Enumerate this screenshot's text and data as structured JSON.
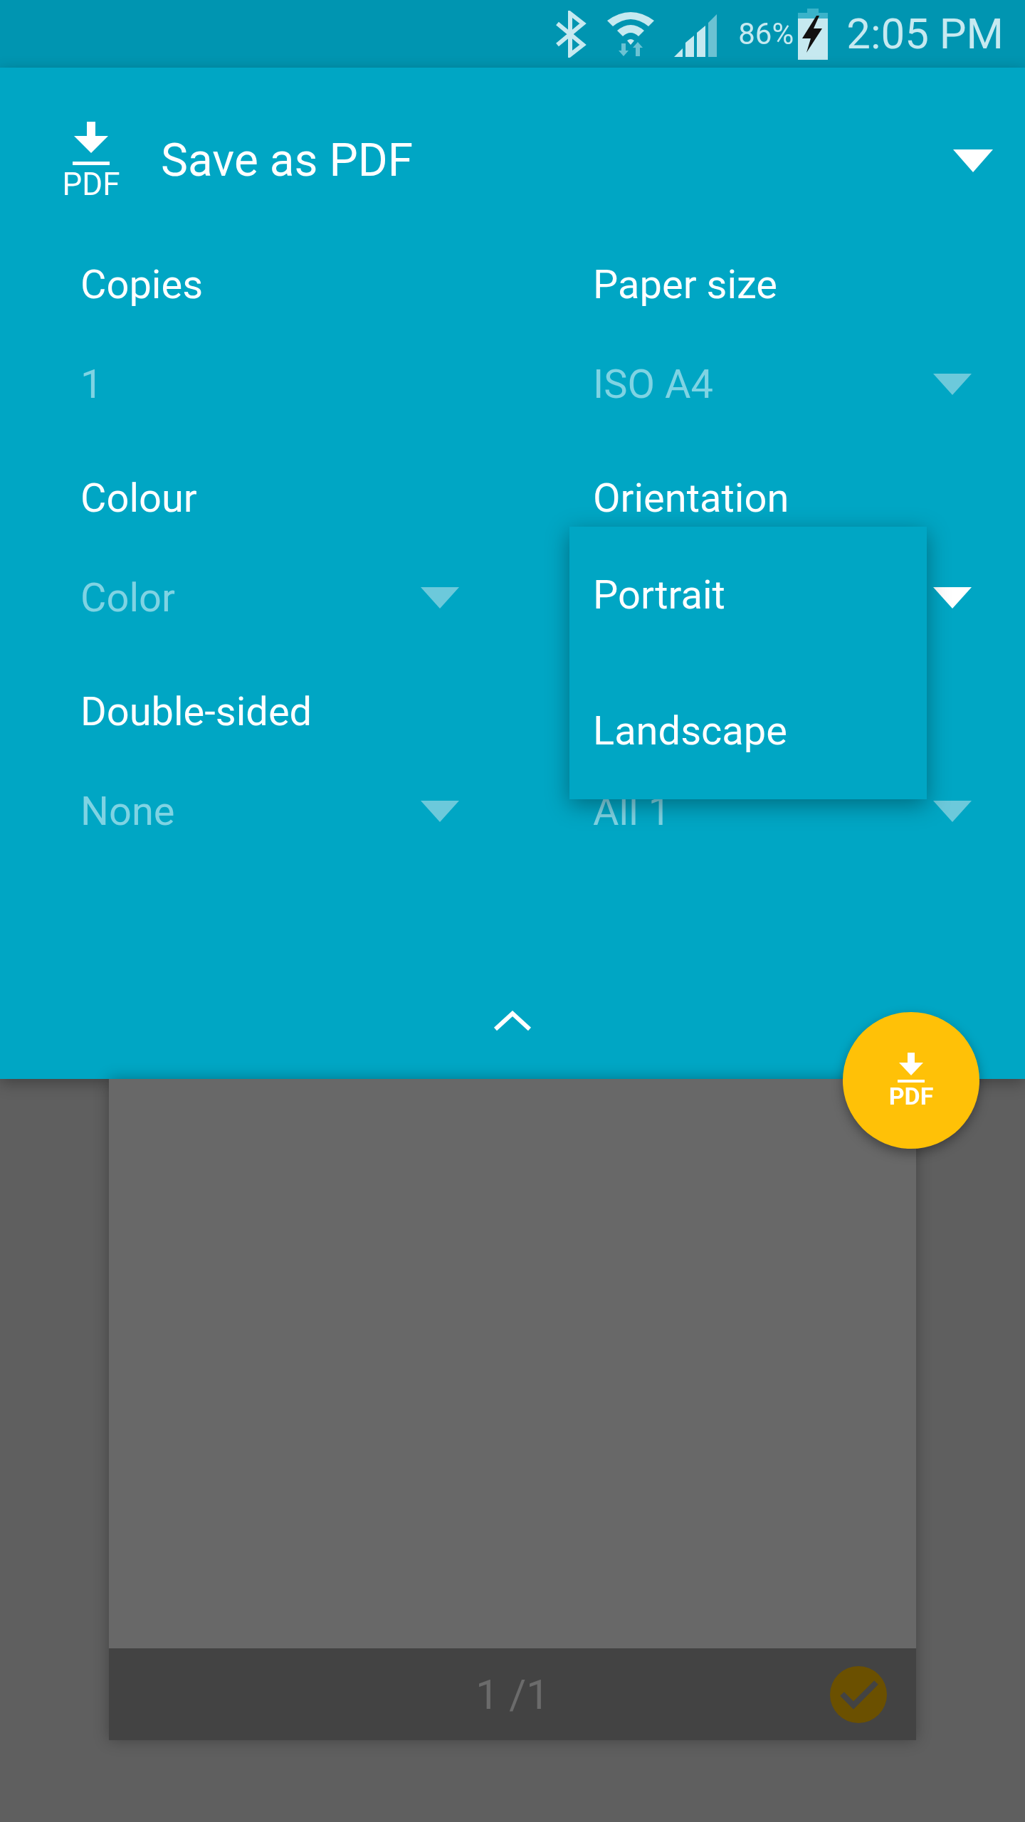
{
  "status_bar": {
    "battery": "86%",
    "time": "2:05 PM"
  },
  "header": {
    "icon_label": "PDF",
    "title": "Save as PDF"
  },
  "options": [
    {
      "label": "Copies",
      "value": "1",
      "kind": "text"
    },
    {
      "label": "Paper size",
      "value": "ISO A4",
      "kind": "dropdown",
      "expanded": false
    },
    {
      "label": "Colour",
      "value": "Color",
      "kind": "dropdown",
      "expanded": false
    },
    {
      "label": "Orientation",
      "kind": "dropdown",
      "expanded": true,
      "menu": [
        {
          "label": "Portrait"
        },
        {
          "label": "Landscape"
        }
      ]
    },
    {
      "label": "Double-sided",
      "value": "None",
      "kind": "dropdown",
      "expanded": false
    },
    {
      "value": "All 1",
      "kind": "dropdown",
      "expanded": false
    }
  ],
  "fab": {
    "label": "PDF"
  },
  "preview": {
    "page_indicator": "1 /1",
    "selected": true
  }
}
